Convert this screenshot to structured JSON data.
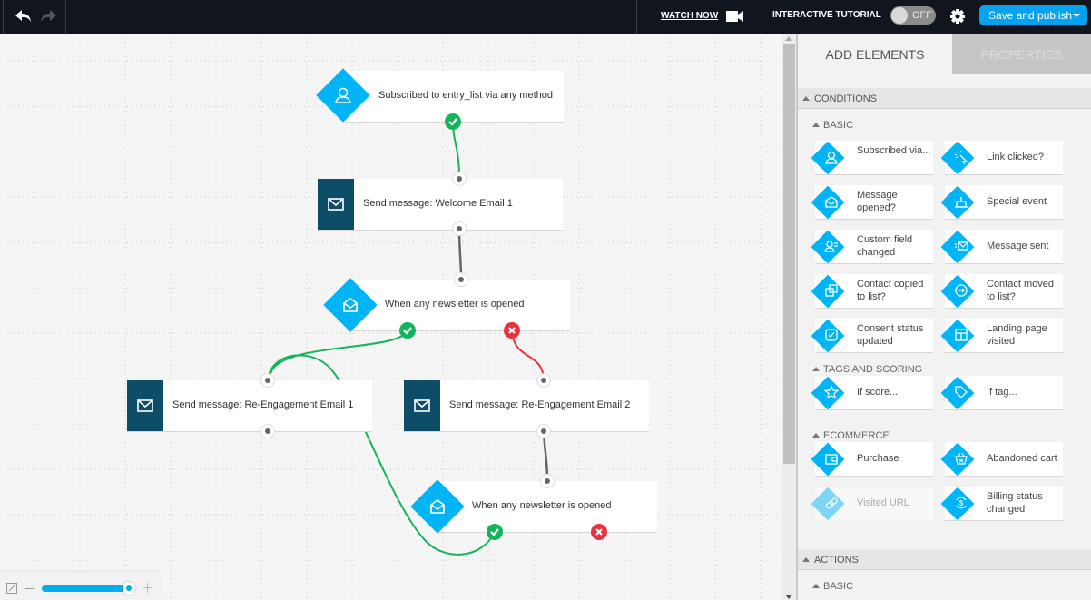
{
  "topbar": {
    "undo_icon": "undo-arrow",
    "redo_icon": "redo-arrow",
    "watch_now_label": "WATCH NOW",
    "video_icon": "video-camera",
    "tutorial_label": "INTERACTIVE TUTORIAL",
    "tutorial_toggle_state": "OFF",
    "settings_icon": "gear",
    "publish_label": "Save and publish"
  },
  "canvas": {
    "nodes": [
      {
        "id": "n1",
        "type": "condition",
        "icon": "user",
        "label": "Subscribed to entry_list via any method"
      },
      {
        "id": "n2",
        "type": "action",
        "icon": "envelope",
        "label": "Send message: Welcome Email 1"
      },
      {
        "id": "n3",
        "type": "condition",
        "icon": "open-envelope",
        "label": "When any newsletter is opened"
      },
      {
        "id": "n4",
        "type": "action",
        "icon": "envelope",
        "label": "Send message: Re-Engagement Email 1"
      },
      {
        "id": "n5",
        "type": "action",
        "icon": "envelope",
        "label": "Send message: Re-Engagement Email 2"
      },
      {
        "id": "n6",
        "type": "condition",
        "icon": "open-envelope",
        "label": "When any newsletter is opened"
      }
    ],
    "connections": [
      {
        "from": "n1",
        "branch": "yes",
        "to": "n2"
      },
      {
        "from": "n2",
        "branch": "next",
        "to": "n3"
      },
      {
        "from": "n3",
        "branch": "yes",
        "to": "n4"
      },
      {
        "from": "n3",
        "branch": "no",
        "to": "n5"
      },
      {
        "from": "n5",
        "branch": "next",
        "to": "n6"
      },
      {
        "from": "n6",
        "branch": "yes",
        "to": "n4"
      }
    ],
    "colors": {
      "yes": "#14b45a",
      "no": "#e8333e",
      "next": "#666666",
      "condition": "#00b4f5",
      "action": "#0e4d68"
    }
  },
  "zoom_control": {
    "fit_icon": "fit-to-screen",
    "minus_icon": "minus",
    "plus_icon": "plus",
    "zoom_level": 1.0
  },
  "panel": {
    "tabs": [
      {
        "label": "ADD ELEMENTS",
        "active": true
      },
      {
        "label": "PROPERTIES",
        "active": false
      }
    ],
    "sections": [
      {
        "title": "CONDITIONS",
        "groups": [
          {
            "title": "BASIC",
            "items": [
              {
                "label": "Subscribed via...",
                "icon": "user"
              },
              {
                "label": "Link clicked?",
                "icon": "cursor-click"
              },
              {
                "label": "Message opened?",
                "icon": "open-envelope"
              },
              {
                "label": "Special event",
                "icon": "cake"
              },
              {
                "label": "Custom field changed",
                "icon": "user-fields"
              },
              {
                "label": "Message sent",
                "icon": "envelope-sent"
              },
              {
                "label": "Contact copied to list?",
                "icon": "copy"
              },
              {
                "label": "Contact moved to list?",
                "icon": "arrow-circle"
              },
              {
                "label": "Consent status updated",
                "icon": "check-square"
              },
              {
                "label": "Landing page visited",
                "icon": "layout"
              }
            ]
          },
          {
            "title": "TAGS AND SCORING",
            "items": [
              {
                "label": "If score...",
                "icon": "star"
              },
              {
                "label": "If tag...",
                "icon": "tag"
              }
            ]
          },
          {
            "title": "ECOMMERCE",
            "items": [
              {
                "label": "Purchase",
                "icon": "wallet"
              },
              {
                "label": "Abandoned cart",
                "icon": "basket"
              },
              {
                "label": "Visited URL",
                "icon": "link",
                "disabled": true
              },
              {
                "label": "Billing status changed",
                "icon": "dollar-cycle"
              }
            ]
          }
        ]
      },
      {
        "title": "ACTIONS",
        "groups": [
          {
            "title": "BASIC",
            "items": []
          }
        ]
      }
    ]
  }
}
